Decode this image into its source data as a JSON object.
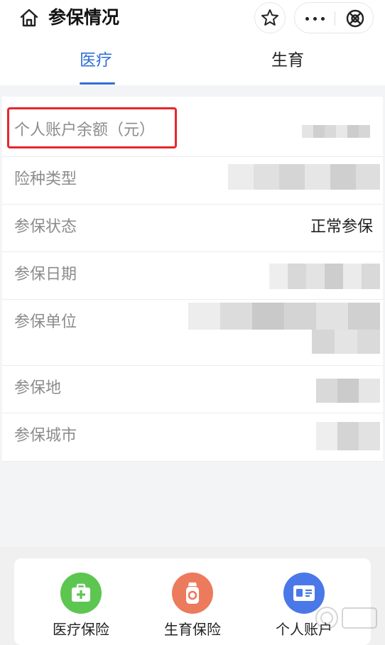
{
  "header": {
    "title": "参保情况"
  },
  "tabs": [
    {
      "label": "医疗",
      "active": true
    },
    {
      "label": "生育",
      "active": false
    }
  ],
  "rows": [
    {
      "label": "个人账户余额（元）",
      "value": ""
    },
    {
      "label": "险种类型",
      "value": ""
    },
    {
      "label": "参保状态",
      "value": "正常参保"
    },
    {
      "label": "参保日期",
      "value": ""
    },
    {
      "label": "参保单位",
      "value": ""
    },
    {
      "label": "参保地",
      "value": ""
    },
    {
      "label": "参保城市",
      "value": ""
    }
  ],
  "bottom_nav": [
    {
      "label": "医疗保险",
      "icon": "medical-kit-icon",
      "color": "#5cc651"
    },
    {
      "label": "生育保险",
      "icon": "baby-bottle-icon",
      "color": "#ec7a5c"
    },
    {
      "label": "个人账户",
      "icon": "id-card-icon",
      "color": "#4a78e8"
    }
  ],
  "colors": {
    "accent": "#2f6fd8",
    "highlight": "#e8262b"
  }
}
